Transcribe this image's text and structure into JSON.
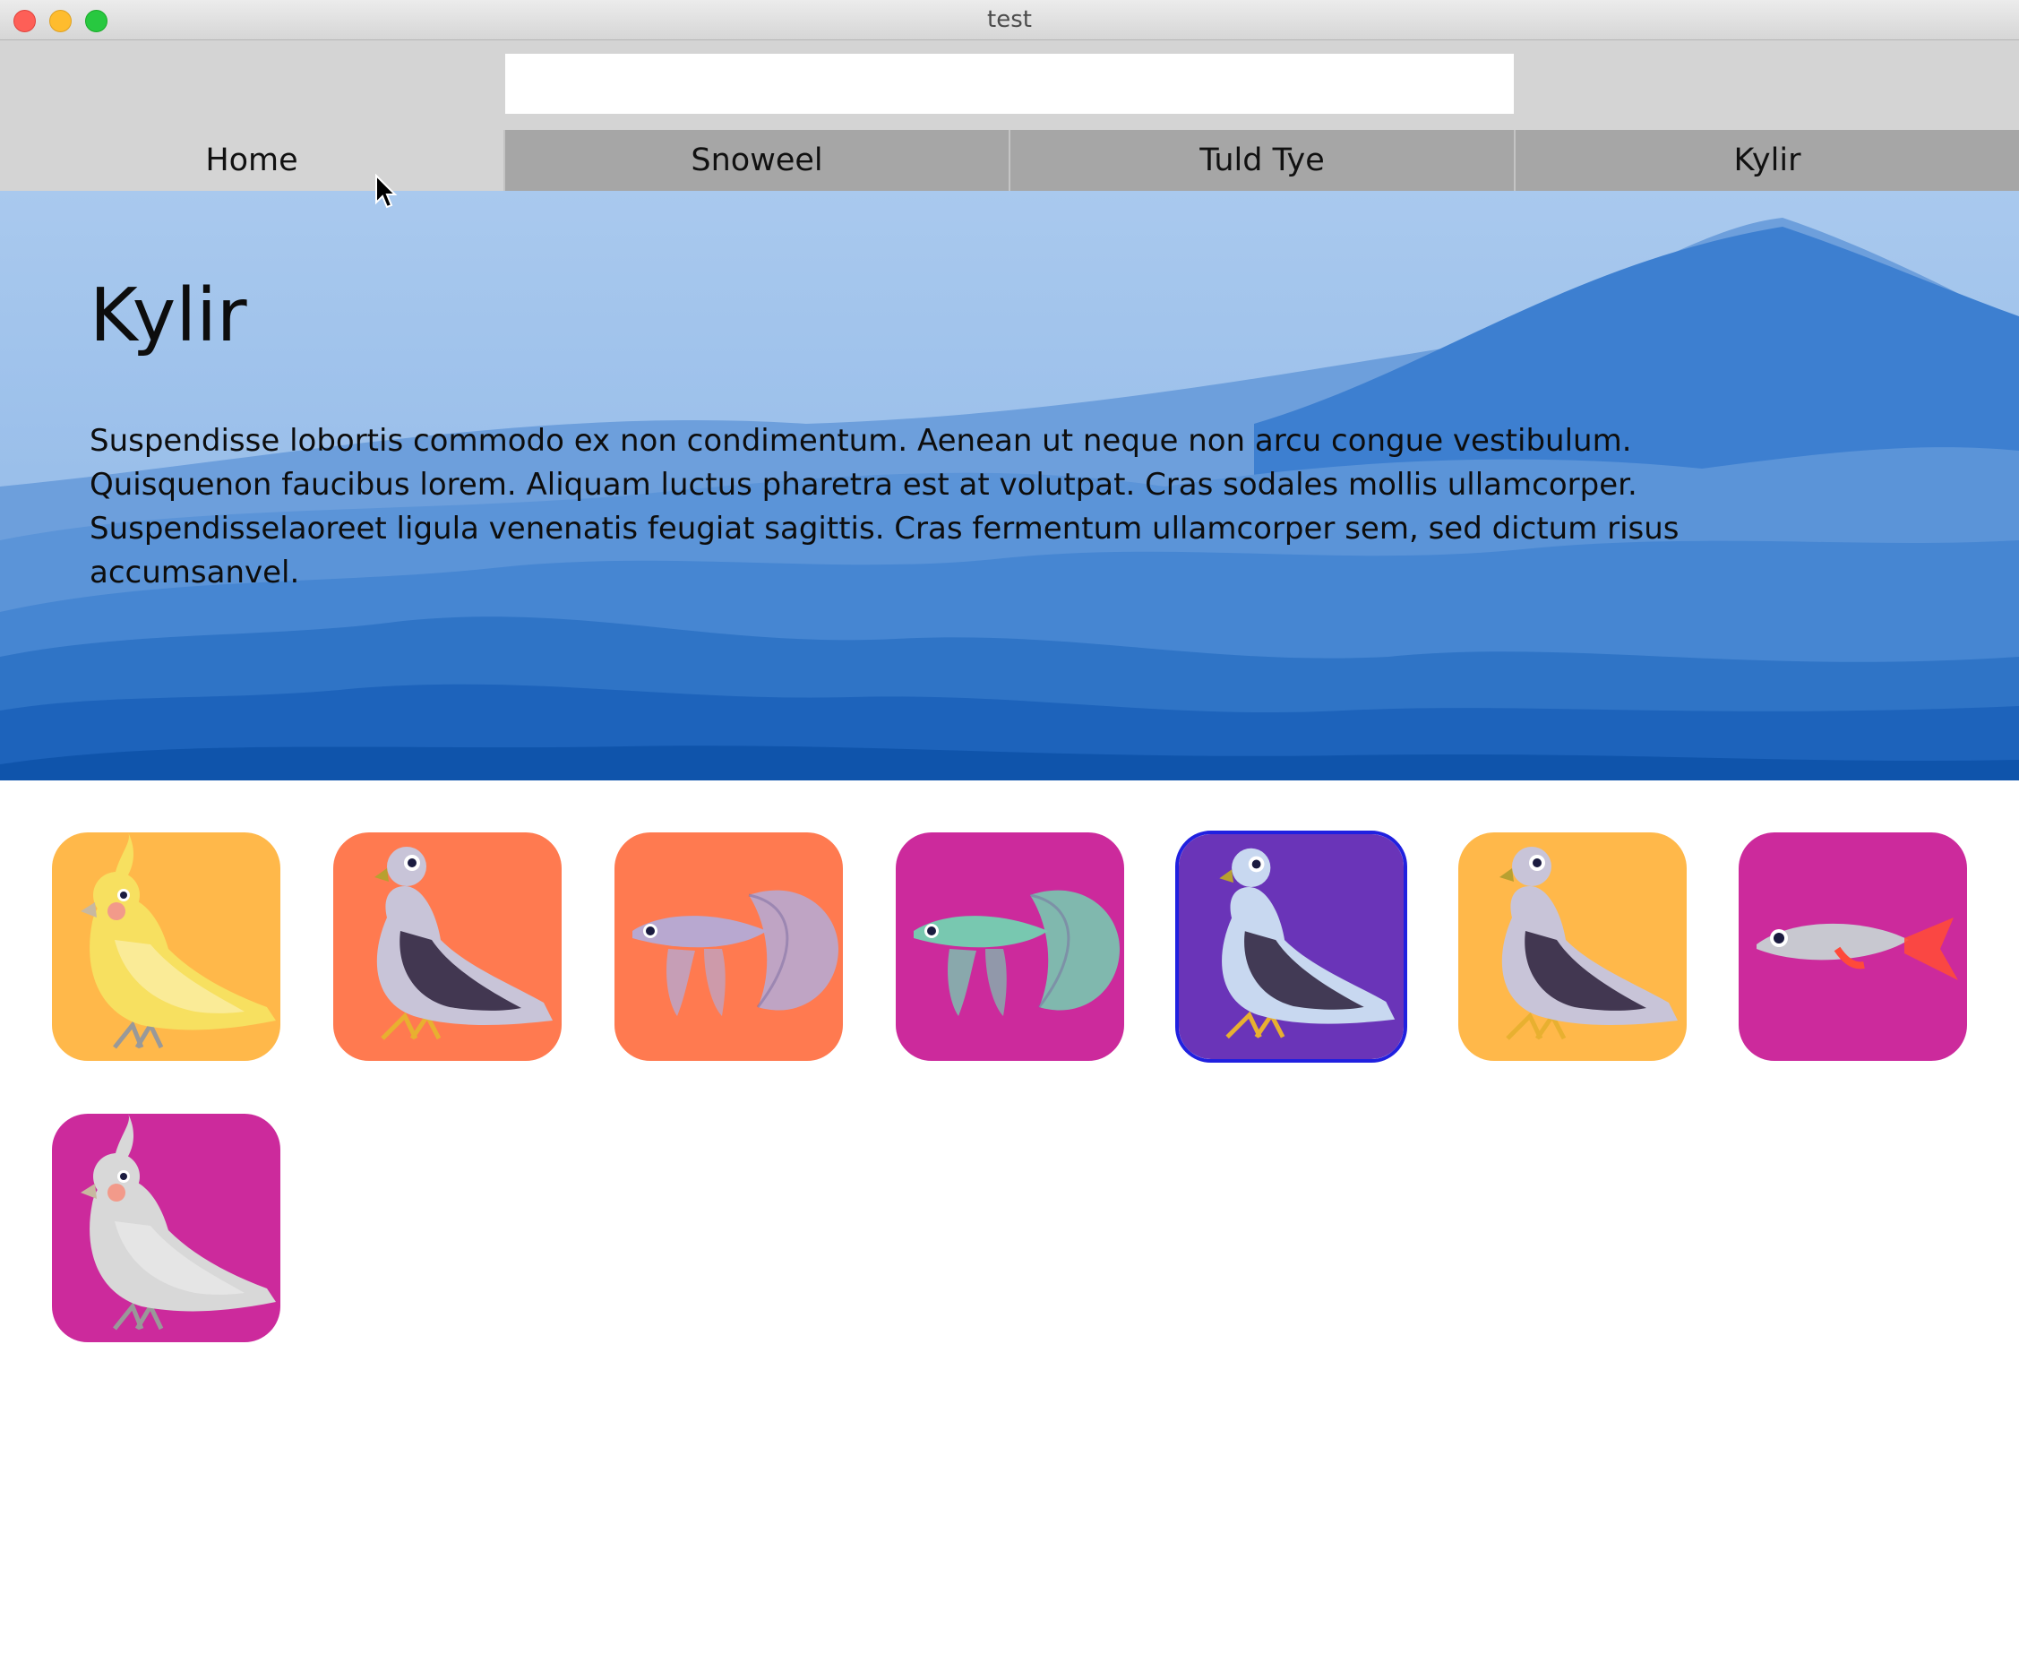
{
  "window": {
    "title": "test"
  },
  "search": {
    "value": "",
    "placeholder": ""
  },
  "tabs": [
    {
      "label": "Home",
      "active": true
    },
    {
      "label": "Snoweel",
      "active": false
    },
    {
      "label": "Tuld Tye",
      "active": false
    },
    {
      "label": "Kylir",
      "active": false
    }
  ],
  "hero": {
    "title": "Kylir",
    "paragraph_lines": [
      "Suspendisse lobortis commodo ex non condimentum. Aenean ut neque non arcu congue vestibulum.",
      "Quisquenon faucibus lorem. Aliquam luctus pharetra est at volutpat. Cras sodales mollis ullamcorper.",
      "Suspendisselaoreet ligula venenatis feugiat sagittis. Cras fermentum ullamcorper sem, sed dictum risus",
      "accumsanvel."
    ]
  },
  "tiles": [
    {
      "icon": "cockatiel-icon",
      "background": "#ffb84a",
      "animal_color": "#f7e060",
      "selected": false
    },
    {
      "icon": "pigeon-icon",
      "background": "#ff7a50",
      "animal_color": "#c8c4d8",
      "selected": false
    },
    {
      "icon": "betta-fish-icon",
      "background": "#ff7a50",
      "animal_color": "#b8a8d0",
      "selected": false
    },
    {
      "icon": "betta-fish-icon",
      "background": "#cc2a9c",
      "animal_color": "#78c8b0",
      "selected": false
    },
    {
      "icon": "pigeon-icon",
      "background": "#6a34b8",
      "animal_color": "#c8d8f0",
      "selected": true
    },
    {
      "icon": "pigeon-icon",
      "background": "#ffb84a",
      "animal_color": "#c8c4d8",
      "selected": false
    },
    {
      "icon": "fish-icon",
      "background": "#cc2a9c",
      "animal_color": "#c8c8d0",
      "selected": false
    },
    {
      "icon": "cockatiel-icon",
      "background": "#cc2a9c",
      "animal_color": "#d8d8d8",
      "selected": false
    }
  ],
  "colors": {
    "tab_inactive": "#a6a6a6",
    "tab_active": "#d4d4d4",
    "selection_border": "#2020e0"
  },
  "cursor": {
    "icon": "mouse-pointer-icon"
  }
}
